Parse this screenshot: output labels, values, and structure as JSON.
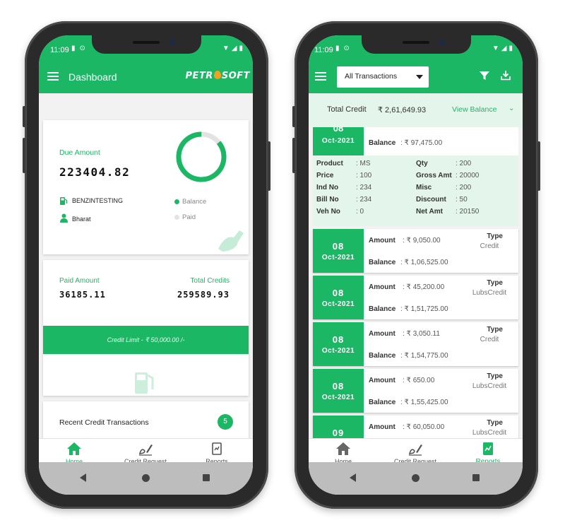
{
  "colors": {
    "brand_green": "#1cb764",
    "light_green_bg": "#e4f5eb",
    "ring_light": "#e3e3e3"
  },
  "left": {
    "status": {
      "time": "11:09"
    },
    "appbar": {
      "title": "Dashboard",
      "logo": {
        "before": "PETR",
        "after": "SOFT"
      }
    },
    "due_card": {
      "label": "Due Amount",
      "amount": "223404.82",
      "customer": "BENZINTESTING",
      "user": "Bharat",
      "legend_balance": "Balance",
      "legend_paid": "Paid",
      "donut_paid_fraction": 0.14
    },
    "paid_card": {
      "paid_label": "Paid Amount",
      "paid_value": "36185.11",
      "credits_label": "Total Credits",
      "credits_value": "259589.93",
      "credit_limit": "Credit Limit - ₹ 50,000.00 /-"
    },
    "recent": {
      "label": "Recent Credit Transactions",
      "count": "5"
    },
    "nav": {
      "home": "Home",
      "credit_request": "Credit Request",
      "reports": "Reports"
    }
  },
  "right": {
    "status": {
      "time": "11:09"
    },
    "filter": {
      "selected": "All Transactions"
    },
    "summary": {
      "label": "Total Credit",
      "value": "₹ 2,61,649.93",
      "view_balance": "View Balance"
    },
    "expanded": {
      "month": "Oct-2021",
      "balance_label": "Balance",
      "balance_value": ": ₹ 97,475.00",
      "left_details": [
        {
          "label": "Product",
          "value": ": MS"
        },
        {
          "label": "Price",
          "value": ": 100"
        },
        {
          "label": "Ind No",
          "value": ": 234"
        },
        {
          "label": "Bill No",
          "value": ": 234"
        },
        {
          "label": "Veh No",
          "value": ": 0"
        }
      ],
      "right_details": [
        {
          "label": "Qty",
          "value": ": 200"
        },
        {
          "label": "Gross Amt",
          "value": ": 20000"
        },
        {
          "label": "Misc",
          "value": ": 200"
        },
        {
          "label": "Discount",
          "value": ": 50"
        },
        {
          "label": "Net Amt",
          "value": ": 20150"
        }
      ]
    },
    "transactions": [
      {
        "day": "08",
        "month": "Oct-2021",
        "amount": ": ₹ 9,050.00",
        "balance": ": ₹ 1,06,525.00",
        "type_label": "Type",
        "type": "Credit"
      },
      {
        "day": "08",
        "month": "Oct-2021",
        "amount": ": ₹ 45,200.00",
        "balance": ": ₹ 1,51,725.00",
        "type_label": "Type",
        "type": "LubsCredit"
      },
      {
        "day": "08",
        "month": "Oct-2021",
        "amount": ": ₹ 3,050.11",
        "balance": ": ₹ 1,54,775.00",
        "type_label": "Type",
        "type": "Credit"
      },
      {
        "day": "08",
        "month": "Oct-2021",
        "amount": ": ₹ 650.00",
        "balance": ": ₹ 1,55,425.00",
        "type_label": "Type",
        "type": "LubsCredit"
      },
      {
        "day": "09",
        "month": "",
        "amount": ": ₹ 60,050.00",
        "balance": "",
        "type_label": "Type",
        "type": "LubsCredit"
      }
    ],
    "labels": {
      "amount": "Amount",
      "balance": "Balance"
    },
    "nav": {
      "home": "Home",
      "credit_request": "Credit Request",
      "reports": "Reports"
    }
  }
}
